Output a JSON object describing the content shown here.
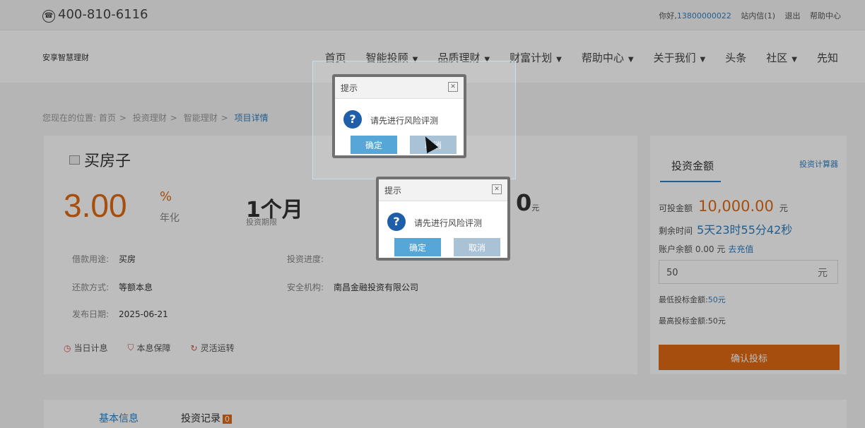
{
  "topbar": {
    "phone": "400-810-6116",
    "greeting": "你好,",
    "user": "13800000022",
    "inbox": "站内信(1)",
    "logout": "退出",
    "help": "帮助中心"
  },
  "header": {
    "logo": "安享智慧理财",
    "nav": [
      {
        "label": "首页",
        "caret": false
      },
      {
        "label": "智能投顾",
        "caret": true
      },
      {
        "label": "品质理财",
        "caret": true
      },
      {
        "label": "财富计划",
        "caret": true
      },
      {
        "label": "帮助中心",
        "caret": true
      },
      {
        "label": "关于我们",
        "caret": true
      },
      {
        "label": "头条",
        "caret": false
      },
      {
        "label": "社区",
        "caret": true
      },
      {
        "label": "先知",
        "caret": false
      }
    ]
  },
  "breadcrumb": {
    "prefix": "您现在的位置:",
    "home": "首页",
    "l2": "投资理财",
    "l3": "智能理财",
    "current": "项目详情",
    "separator": ">"
  },
  "product": {
    "title": "买房子",
    "rate": "3.00",
    "rate_unit": "%",
    "rate_label": "年化",
    "term": "1个月",
    "term_label": "投资期限",
    "amount_partial": "0",
    "amount_unit": "元",
    "fields": {
      "purpose_label": "借款用途:",
      "purpose": "买房",
      "progress_label": "投资进度:",
      "repay_label": "还款方式:",
      "repay": "等额本息",
      "agency_label": "安全机构:",
      "agency": "南昌金融投资有限公司",
      "date_label": "发布日期:",
      "date": "2025-06-21"
    },
    "tags": [
      "当日计息",
      "本息保障",
      "灵活运转"
    ]
  },
  "invest": {
    "title": "投资金额",
    "calculator": "投资计算器",
    "available_label": "可投金额",
    "available": "10,000.00",
    "unit": "元",
    "remaining_label": "剩余时间",
    "remaining": "5天23时55分42秒",
    "balance_label": "账户余额",
    "balance": "0.00",
    "recharge": "去充值",
    "input_value": "50",
    "min_label": "最低投标金额:",
    "min_value": "50元",
    "max_label": "最高投标金额:",
    "max_value": "50元",
    "confirm": "确认投标"
  },
  "tabs": {
    "basic": "基本信息",
    "records": "投资记录",
    "records_count": "0"
  },
  "dialogs": [
    {
      "title": "提示",
      "message": "请先进行风险评测",
      "ok": "确定",
      "cancel": "取消"
    },
    {
      "title": "提示",
      "message": "请先进行风险评测",
      "ok": "确定",
      "cancel": "取消"
    }
  ],
  "colors": {
    "accent": "#e06a12",
    "link": "#2f7fc1",
    "dialog_button": "#56a7d8"
  }
}
